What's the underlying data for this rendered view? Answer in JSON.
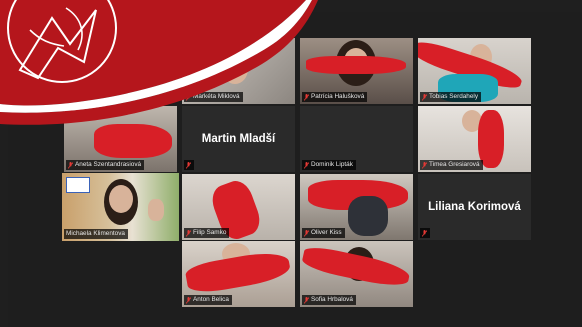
{
  "participants": [
    {
      "name": "Markéta Miklová"
    },
    {
      "name": "Patrícia Halušková"
    },
    {
      "name": "Tobias Serdahely"
    },
    {
      "name": "Aneta Szentandrasiová"
    },
    {
      "name": "Martin Mladší"
    },
    {
      "name": "Dominik Lipták"
    },
    {
      "name": "Timea Gresiarová"
    },
    {
      "name": "Michaela Klimentova"
    },
    {
      "name": "Filip Samko"
    },
    {
      "name": "Oliver Kiss"
    },
    {
      "name": "Liliana Korimová"
    },
    {
      "name": "Anton Belica"
    },
    {
      "name": "Sofia Hrbalová"
    }
  ],
  "active_speaker": "Michaela Klimentova",
  "colors": {
    "brand_red": "#b5161c",
    "active_border": "#f1d24a",
    "tile_bg": "#2a2a2a",
    "scarf": "#d81f27"
  },
  "icons": [
    "mic-muted-icon",
    "school-logo-icon"
  ]
}
